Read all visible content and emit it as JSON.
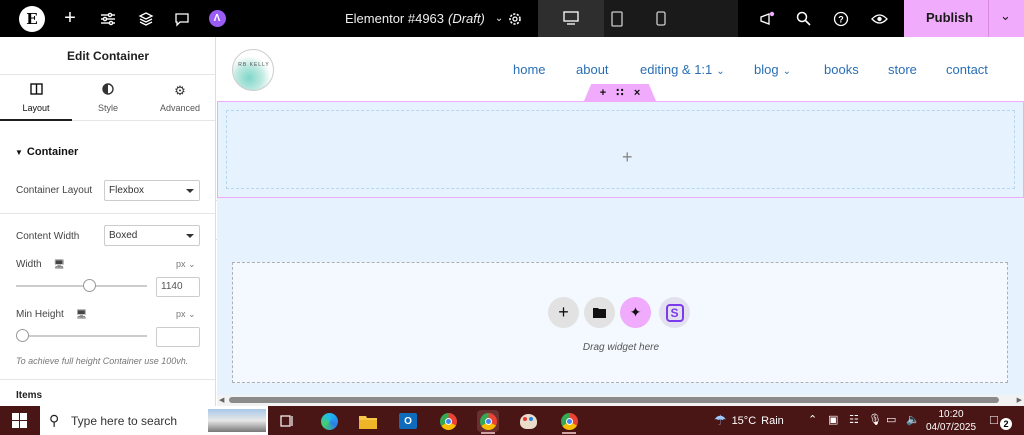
{
  "topbar": {
    "doc_name": "Elementor #4963",
    "doc_status": "(Draft)",
    "publish_label": "Publish"
  },
  "panel": {
    "title": "Edit Container",
    "tabs": [
      {
        "label": "Layout",
        "icon": "layout-icon"
      },
      {
        "label": "Style",
        "icon": "half-circle-icon"
      },
      {
        "label": "Advanced",
        "icon": "gear-icon"
      }
    ],
    "section": "Container",
    "container_layout_label": "Container Layout",
    "container_layout_value": "Flexbox",
    "content_width_label": "Content Width",
    "content_width_value": "Boxed",
    "width_label": "Width",
    "width_unit": "px",
    "width_value": "1140",
    "width_slider_fraction": 0.57,
    "min_height_label": "Min Height",
    "min_height_unit": "px",
    "min_height_value": "",
    "min_height_slider_fraction": 0.0,
    "hint": "To achieve full height Container use 100vh.",
    "items_label": "Items"
  },
  "site": {
    "logo_text": "RB KELLY",
    "nav": [
      {
        "label": "home"
      },
      {
        "label": "about"
      },
      {
        "label": "editing & 1:1",
        "dropdown": true
      },
      {
        "label": "blog",
        "dropdown": true
      },
      {
        "label": "books"
      },
      {
        "label": "store"
      },
      {
        "label": "contact"
      }
    ]
  },
  "canvas": {
    "drag_text": "Drag widget here"
  },
  "taskbar": {
    "search_placeholder": "Type here to search",
    "weather_temp": "15°C",
    "weather_text": "Rain",
    "time": "10:20",
    "date": "04/07/2025",
    "notification_count": "2"
  },
  "colors": {
    "accent": "#f0abfc",
    "canvas_bg": "#e6f3fe",
    "nav_link": "#2a6fb5",
    "taskbar": "#4a1515"
  }
}
